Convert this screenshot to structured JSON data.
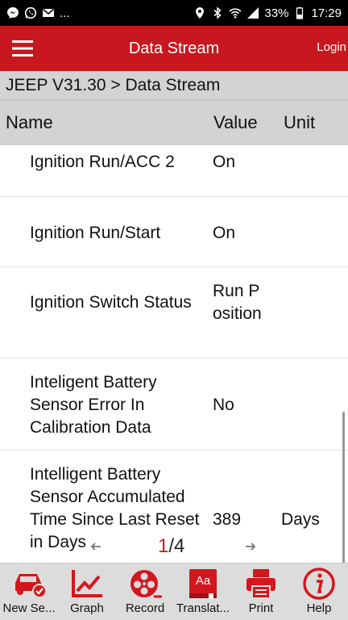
{
  "status_bar": {
    "left_text": "...",
    "battery": "33%",
    "time": "17:29"
  },
  "app_bar": {
    "title": "Data Stream",
    "login": "Login"
  },
  "breadcrumb": "JEEP V31.30 > Data Stream",
  "columns": {
    "name": "Name",
    "value": "Value",
    "unit": "Unit"
  },
  "rows": [
    {
      "name": "Ignition Run/ACC 2",
      "value": "On",
      "unit": ""
    },
    {
      "name": "Ignition Run/Start",
      "value": "On",
      "unit": ""
    },
    {
      "name": "Ignition Switch Status",
      "value": "Run Position",
      "unit": ""
    },
    {
      "name": "Inteligent Battery Sensor Error In Calibration Data",
      "value": "No",
      "unit": ""
    },
    {
      "name": "Intelligent Battery Sensor Accumulated Time Since Last Reset in Days",
      "value": "389",
      "unit": "Days"
    }
  ],
  "pager": {
    "current": "1",
    "total": "/4"
  },
  "toolbar": [
    {
      "label": "New Se...",
      "icon": "car-check-icon"
    },
    {
      "label": "Graph",
      "icon": "graph-icon"
    },
    {
      "label": "Record",
      "icon": "record-reel-icon"
    },
    {
      "label": "Translat...",
      "icon": "translate-icon"
    },
    {
      "label": "Print",
      "icon": "printer-icon"
    },
    {
      "label": "Help",
      "icon": "help-icon"
    }
  ],
  "colors": {
    "accent": "#c8171e",
    "header_bg": "#d3d3d3",
    "toolbar_bg": "#dcdcdc"
  }
}
